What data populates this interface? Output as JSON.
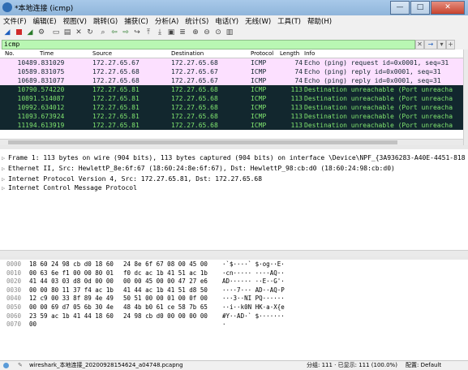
{
  "window": {
    "title": "*本地连接 (icmp)",
    "controls": {
      "minimize": "—",
      "maximize": "□",
      "close": "✕"
    }
  },
  "menu": [
    "文件(F)",
    "编辑(E)",
    "视图(V)",
    "跳转(G)",
    "捕获(C)",
    "分析(A)",
    "统计(S)",
    "电话(Y)",
    "无线(W)",
    "工具(T)",
    "帮助(H)"
  ],
  "filter": {
    "value": "icmp"
  },
  "packet_list": {
    "columns": {
      "no": "No.",
      "time": "Time",
      "source": "Source",
      "destination": "Destination",
      "protocol": "Protocol",
      "length": "Length",
      "info": "Info"
    },
    "rows": [
      {
        "no": "104",
        "time": "89.831029",
        "source": "172.27.65.67",
        "destination": "172.27.65.68",
        "protocol": "ICMP",
        "length": "74",
        "info": "Echo (ping) request  id=0x0001, seq=31",
        "kind": "icmp"
      },
      {
        "no": "105",
        "time": "89.831075",
        "source": "172.27.65.68",
        "destination": "172.27.65.67",
        "protocol": "ICMP",
        "length": "74",
        "info": "Echo (ping) reply    id=0x0001, seq=31",
        "kind": "icmp"
      },
      {
        "no": "106",
        "time": "89.831077",
        "source": "172.27.65.68",
        "destination": "172.27.65.67",
        "protocol": "ICMP",
        "length": "74",
        "info": "Echo (ping) reply    id=0x0001, seq=31",
        "kind": "icmp"
      },
      {
        "no": "107",
        "time": "90.574220",
        "source": "172.27.65.81",
        "destination": "172.27.65.68",
        "protocol": "ICMP",
        "length": "113",
        "info": "Destination unreachable (Port unreacha",
        "kind": "err"
      },
      {
        "no": "108",
        "time": "91.514087",
        "source": "172.27.65.81",
        "destination": "172.27.65.68",
        "protocol": "ICMP",
        "length": "113",
        "info": "Destination unreachable (Port unreacha",
        "kind": "err"
      },
      {
        "no": "109",
        "time": "92.634012",
        "source": "172.27.65.81",
        "destination": "172.27.65.68",
        "protocol": "ICMP",
        "length": "113",
        "info": "Destination unreachable (Port unreacha",
        "kind": "err"
      },
      {
        "no": "110",
        "time": "93.673924",
        "source": "172.27.65.81",
        "destination": "172.27.65.68",
        "protocol": "ICMP",
        "length": "113",
        "info": "Destination unreachable (Port unreacha",
        "kind": "err"
      },
      {
        "no": "111",
        "time": "94.613919",
        "source": "172.27.65.81",
        "destination": "172.27.65.68",
        "protocol": "ICMP",
        "length": "113",
        "info": "Destination unreachable (Port unreacha",
        "kind": "err"
      }
    ]
  },
  "details": [
    "Frame 1: 113 bytes on wire (904 bits), 113 bytes captured (904 bits) on interface \\Device\\NPF_{3A936283-A40E-4451-818",
    "Ethernet II, Src: HewlettP_8e:6f:67 (18:60:24:8e:6f:67), Dst: HewlettP_98:cb:d0 (18:60:24:98:cb:d0)",
    "Internet Protocol Version 4, Src: 172.27.65.81, Dst: 172.27.65.68",
    "Internet Control Message Protocol"
  ],
  "bytes": [
    {
      "offset": "0000",
      "hex1": "18 60 24 98 cb d0 18 60",
      "hex2": "24 8e 6f 67 08 00 45 00",
      "ascii": "·`$····` $·og··E·"
    },
    {
      "offset": "0010",
      "hex1": "00 63 6e f1 00 00 80 01",
      "hex2": "f0 dc ac 1b 41 51 ac 1b",
      "ascii": "·cn····· ····AQ··"
    },
    {
      "offset": "0020",
      "hex1": "41 44 03 03 d8 0d 00 00",
      "hex2": "00 00 45 00 00 47 27 e6",
      "ascii": "AD······ ··E··G'·"
    },
    {
      "offset": "0030",
      "hex1": "00 00 80 11 37 f4 ac 1b",
      "hex2": "41 44 ac 1b 41 51 d8 50",
      "ascii": "····7··· AD··AQ·P"
    },
    {
      "offset": "0040",
      "hex1": "12 c9 00 33 8f 89 4e 49",
      "hex2": "50 51 00 00 01 00 0f 00",
      "ascii": "···3··NI PQ······"
    },
    {
      "offset": "0050",
      "hex1": "00 00 69 d7 05 6b 30 4e",
      "hex2": "48 4b b0 61 ce 58 7b 65",
      "ascii": "··i··k0N HK·a·X{e"
    },
    {
      "offset": "0060",
      "hex1": "23 59 ac 1b 41 44 18 60",
      "hex2": "24 98 cb d0 00 00 00 00",
      "ascii": "#Y··AD·` $·······"
    },
    {
      "offset": "0070",
      "hex1": "00",
      "hex2": "",
      "ascii": "·"
    }
  ],
  "status": {
    "file": "wireshark_本地连接_20200928154624_a04748.pcapng",
    "counts": "分组: 111 · 已显示: 111 (100.0%)",
    "profile": "配置: Default"
  },
  "colors": {
    "icmp_bg": "#fce0ff",
    "err_bg": "#12272e",
    "err_fg": "#7fe36f",
    "filter_bg": "#b9f7b3"
  }
}
